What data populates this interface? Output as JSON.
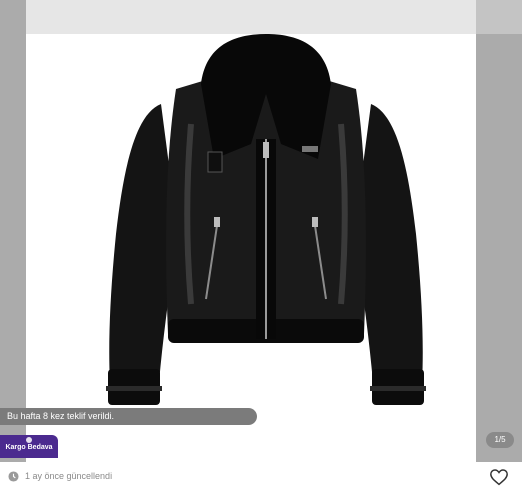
{
  "listing": {
    "offer_banner": "Bu hafta 8 kez teklif verildi.",
    "cargo_badge": "Kargo Bedava",
    "image_counter": "1/5",
    "updated_text": "1 ay önce güncellendi"
  },
  "icons": {
    "favorite": "heart-icon",
    "time": "clock-icon",
    "cargo": "truck-icon"
  },
  "colors": {
    "cargo_badge_bg": "#4b2a8f",
    "offer_banner_bg": "#7b7b7b",
    "counter_bg": "#8a8a8a",
    "muted_text": "#8a8a8a"
  }
}
